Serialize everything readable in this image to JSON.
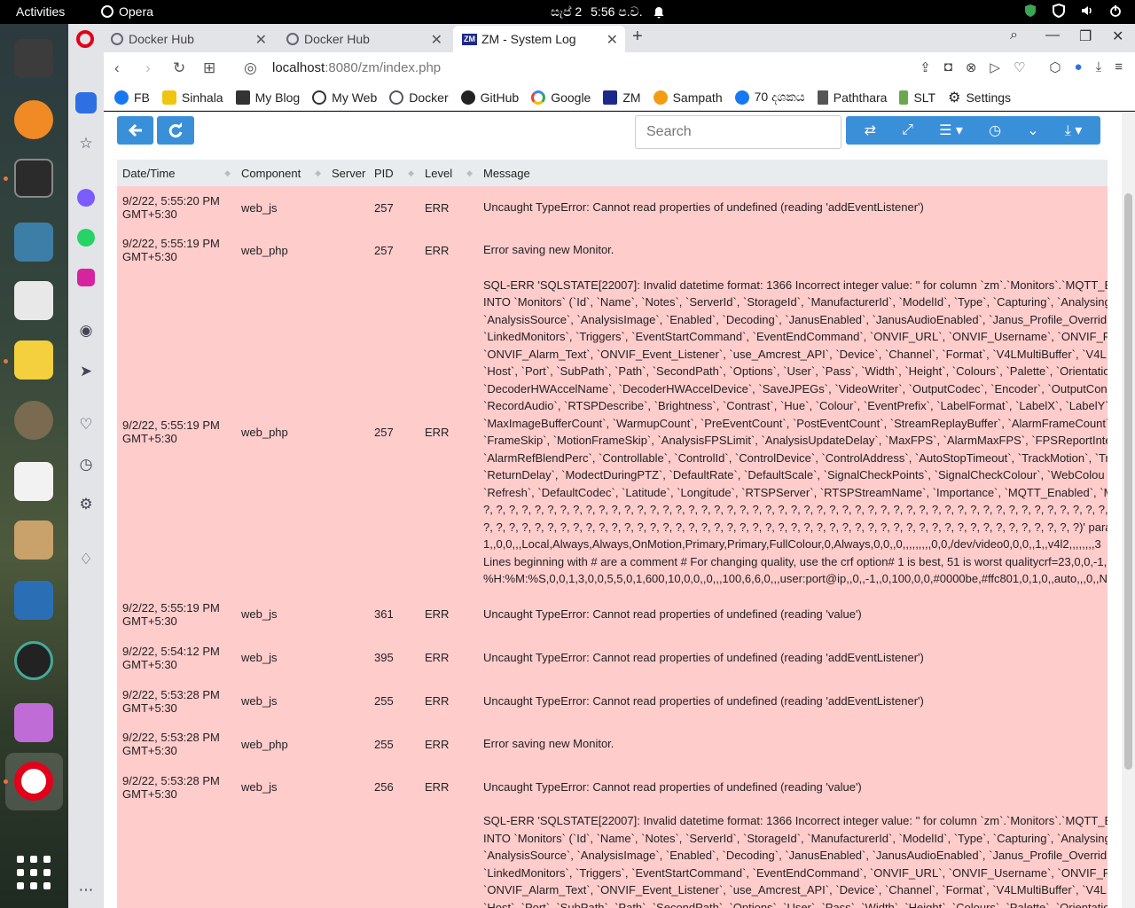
{
  "topbar": {
    "activities": "Activities",
    "app": "Opera",
    "date": "සැප් 2",
    "time": "5:56 ප.ව."
  },
  "browser": {
    "tabs": [
      {
        "title": "Docker Hub",
        "active": false
      },
      {
        "title": "Docker Hub",
        "active": false
      },
      {
        "title": "ZM - System Log",
        "active": true
      }
    ],
    "zm_favicon": "ZM",
    "url_host": "localhost",
    "url_rest": ":8080/zm/index.php",
    "bookmarks": [
      "FB",
      "Sinhala",
      "My Blog",
      "My Web",
      "Docker",
      "GitHub",
      "Google",
      "ZM",
      "Sampath",
      "70 දශකය",
      "Paththara",
      "SLT",
      "Settings"
    ]
  },
  "toolbar": {
    "search_placeholder": "Search"
  },
  "table": {
    "headers": [
      "Date/Time",
      "Component",
      "Server",
      "PID",
      "Level",
      "Message"
    ],
    "rows": [
      {
        "date": "9/2/22, 5:55:20 PM",
        "tz": "GMT+5:30",
        "component": "web_js",
        "server": "",
        "pid": "257",
        "level": "ERR",
        "message": "Uncaught TypeError: Cannot read properties of undefined (reading 'addEventListener')"
      },
      {
        "date": "9/2/22, 5:55:19 PM",
        "tz": "GMT+5:30",
        "component": "web_php",
        "server": "",
        "pid": "257",
        "level": "ERR",
        "message": "Error saving new Monitor."
      },
      {
        "date": "9/2/22, 5:55:19 PM",
        "tz": "GMT+5:30",
        "component": "web_php",
        "server": "",
        "pid": "257",
        "level": "ERR",
        "message": "SQL-ERR 'SQLSTATE[22007]: Invalid datetime format: 1366 Incorrect integer value: '' for column `zm`.`Monitors`.`MQTT_E\nINTO `Monitors` (`Id`, `Name`, `Notes`, `ServerId`, `StorageId`, `ManufacturerId`, `ModelId`, `Type`, `Capturing`, `Analysing\n`AnalysisSource`, `AnalysisImage`, `Enabled`, `Decoding`, `JanusEnabled`, `JanusAudioEnabled`, `Janus_Profile_Overrid\n`LinkedMonitors`, `Triggers`, `EventStartCommand`, `EventEndCommand`, `ONVIF_URL`, `ONVIF_Username`, `ONVIF_P\n`ONVIF_Alarm_Text`, `ONVIF_Event_Listener`, `use_Amcrest_API`, `Device`, `Channel`, `Format`, `V4LMultiBuffer`, `V4L\n`Host`, `Port`, `SubPath`, `Path`, `SecondPath`, `Options`, `User`, `Pass`, `Width`, `Height`, `Colours`, `Palette`, `Orientatio\n`DecoderHWAccelName`, `DecoderHWAccelDevice`, `SaveJPEGs`, `VideoWriter`, `OutputCodec`, `Encoder`, `OutputCon\n`RecordAudio`, `RTSPDescribe`, `Brightness`, `Contrast`, `Hue`, `Colour`, `EventPrefix`, `LabelFormat`, `LabelX`, `LabelY`\n`MaxImageBufferCount`, `WarmupCount`, `PreEventCount`, `PostEventCount`, `StreamReplayBuffer`, `AlarmFrameCount`\n`FrameSkip`, `MotionFrameSkip`, `AnalysisFPSLimit`, `AnalysisUpdateDelay`, `MaxFPS`, `AlarmMaxFPS`, `FPSReportInte\n`AlarmRefBlendPerc`, `Controllable`, `ControlId`, `ControlDevice`, `ControlAddress`, `AutoStopTimeout`, `TrackMotion`, `Tr\n`ReturnDelay`, `ModectDuringPTZ`, `DefaultRate`, `DefaultScale`, `SignalCheckPoints`, `SignalCheckColour`, `WebColou\n`Refresh`, `DefaultCodec`, `Latitude`, `Longitude`, `RTSPServer`, `RTSPStreamName`, `Importance`, `MQTT_Enabled`, `M\n?, ?, ?, ?, ?, ?, ?, ?, ?, ?, ?, ?, ?, ?, ?, ?, ?, ?, ?, ?, ?, ?, ?, ?, ?, ?, ?, ?, ?, ?, ?, ?, ?, ?, ?, ?, ?, ?, ?, ?, ?, ?, ?, ?, ?, ?, ?, ?, ?, ?,\n?, ?, ?, ?, ?, ?, ?, ?, ?, ?, ?, ?, ?, ?, ?, ?, ?, ?, ?, ?, ?, ?, ?, ?, ?, ?, ?, ?, ?, ?, ?, ?, ?, ?, ?, ?, ?, ?, ?, ?, ?, ?, ?, ?, ?, ?, ?)' param\n1,,0,0,,,Local,Always,Always,OnMotion,Primary,Primary,FullColour,0,Always,0,0,,0,,,,,,,,,0,0,/dev/video0,0,0,,1,,v4l2,,,,,,,,3\nLines beginning with # are a comment # For changing quality, use the crf option# 1 is best, 51 is worst qualitycrf=23,0,0,-1,\n%H:%M:%S,0,0,1,3,0,0,5,5,0,1,600,10,0,0,,0,,,100,6,6,0,,,user:port@ip,,0,,-1,,0,100,0,0,#0000be,#ffc801,0,1,0,,auto,,,0,,N"
      },
      {
        "date": "9/2/22, 5:55:19 PM",
        "tz": "GMT+5:30",
        "component": "web_js",
        "server": "",
        "pid": "361",
        "level": "ERR",
        "message": "Uncaught TypeError: Cannot read properties of undefined (reading 'value')"
      },
      {
        "date": "9/2/22, 5:54:12 PM",
        "tz": "GMT+5:30",
        "component": "web_js",
        "server": "",
        "pid": "395",
        "level": "ERR",
        "message": "Uncaught TypeError: Cannot read properties of undefined (reading 'addEventListener')"
      },
      {
        "date": "9/2/22, 5:53:28 PM",
        "tz": "GMT+5:30",
        "component": "web_js",
        "server": "",
        "pid": "255",
        "level": "ERR",
        "message": "Uncaught TypeError: Cannot read properties of undefined (reading 'addEventListener')"
      },
      {
        "date": "9/2/22, 5:53:28 PM",
        "tz": "GMT+5:30",
        "component": "web_php",
        "server": "",
        "pid": "255",
        "level": "ERR",
        "message": "Error saving new Monitor."
      },
      {
        "date": "9/2/22, 5:53:28 PM",
        "tz": "GMT+5:30",
        "component": "web_js",
        "server": "",
        "pid": "256",
        "level": "ERR",
        "message": "Uncaught TypeError: Cannot read properties of undefined (reading 'value')"
      },
      {
        "date": "",
        "tz": "",
        "component": "",
        "server": "",
        "pid": "",
        "level": "",
        "message": "SQL-ERR 'SQLSTATE[22007]: Invalid datetime format: 1366 Incorrect integer value: '' for column `zm`.`Monitors`.`MQTT_E\nINTO `Monitors` (`Id`, `Name`, `Notes`, `ServerId`, `StorageId`, `ManufacturerId`, `ModelId`, `Type`, `Capturing`, `Analysing\n`AnalysisSource`, `AnalysisImage`, `Enabled`, `Decoding`, `JanusEnabled`, `JanusAudioEnabled`, `Janus_Profile_Overrid\n`LinkedMonitors`, `Triggers`, `EventStartCommand`, `EventEndCommand`, `ONVIF_URL`, `ONVIF_Username`, `ONVIF_P\n`ONVIF_Alarm_Text`, `ONVIF_Event_Listener`, `use_Amcrest_API`, `Device`, `Channel`, `Format`, `V4LMultiBuffer`, `V4L\n`Host`, `Port`, `SubPath`, `Path`, `SecondPath`, `Options`, `User`, `Pass`, `Width`, `Height`, `Colours`, `Palette`, `Orientatio"
      }
    ]
  },
  "colors": {
    "row_error": "#ffcccc",
    "button_blue": "#3a8fd9",
    "header_gray": "#e9ecef"
  }
}
